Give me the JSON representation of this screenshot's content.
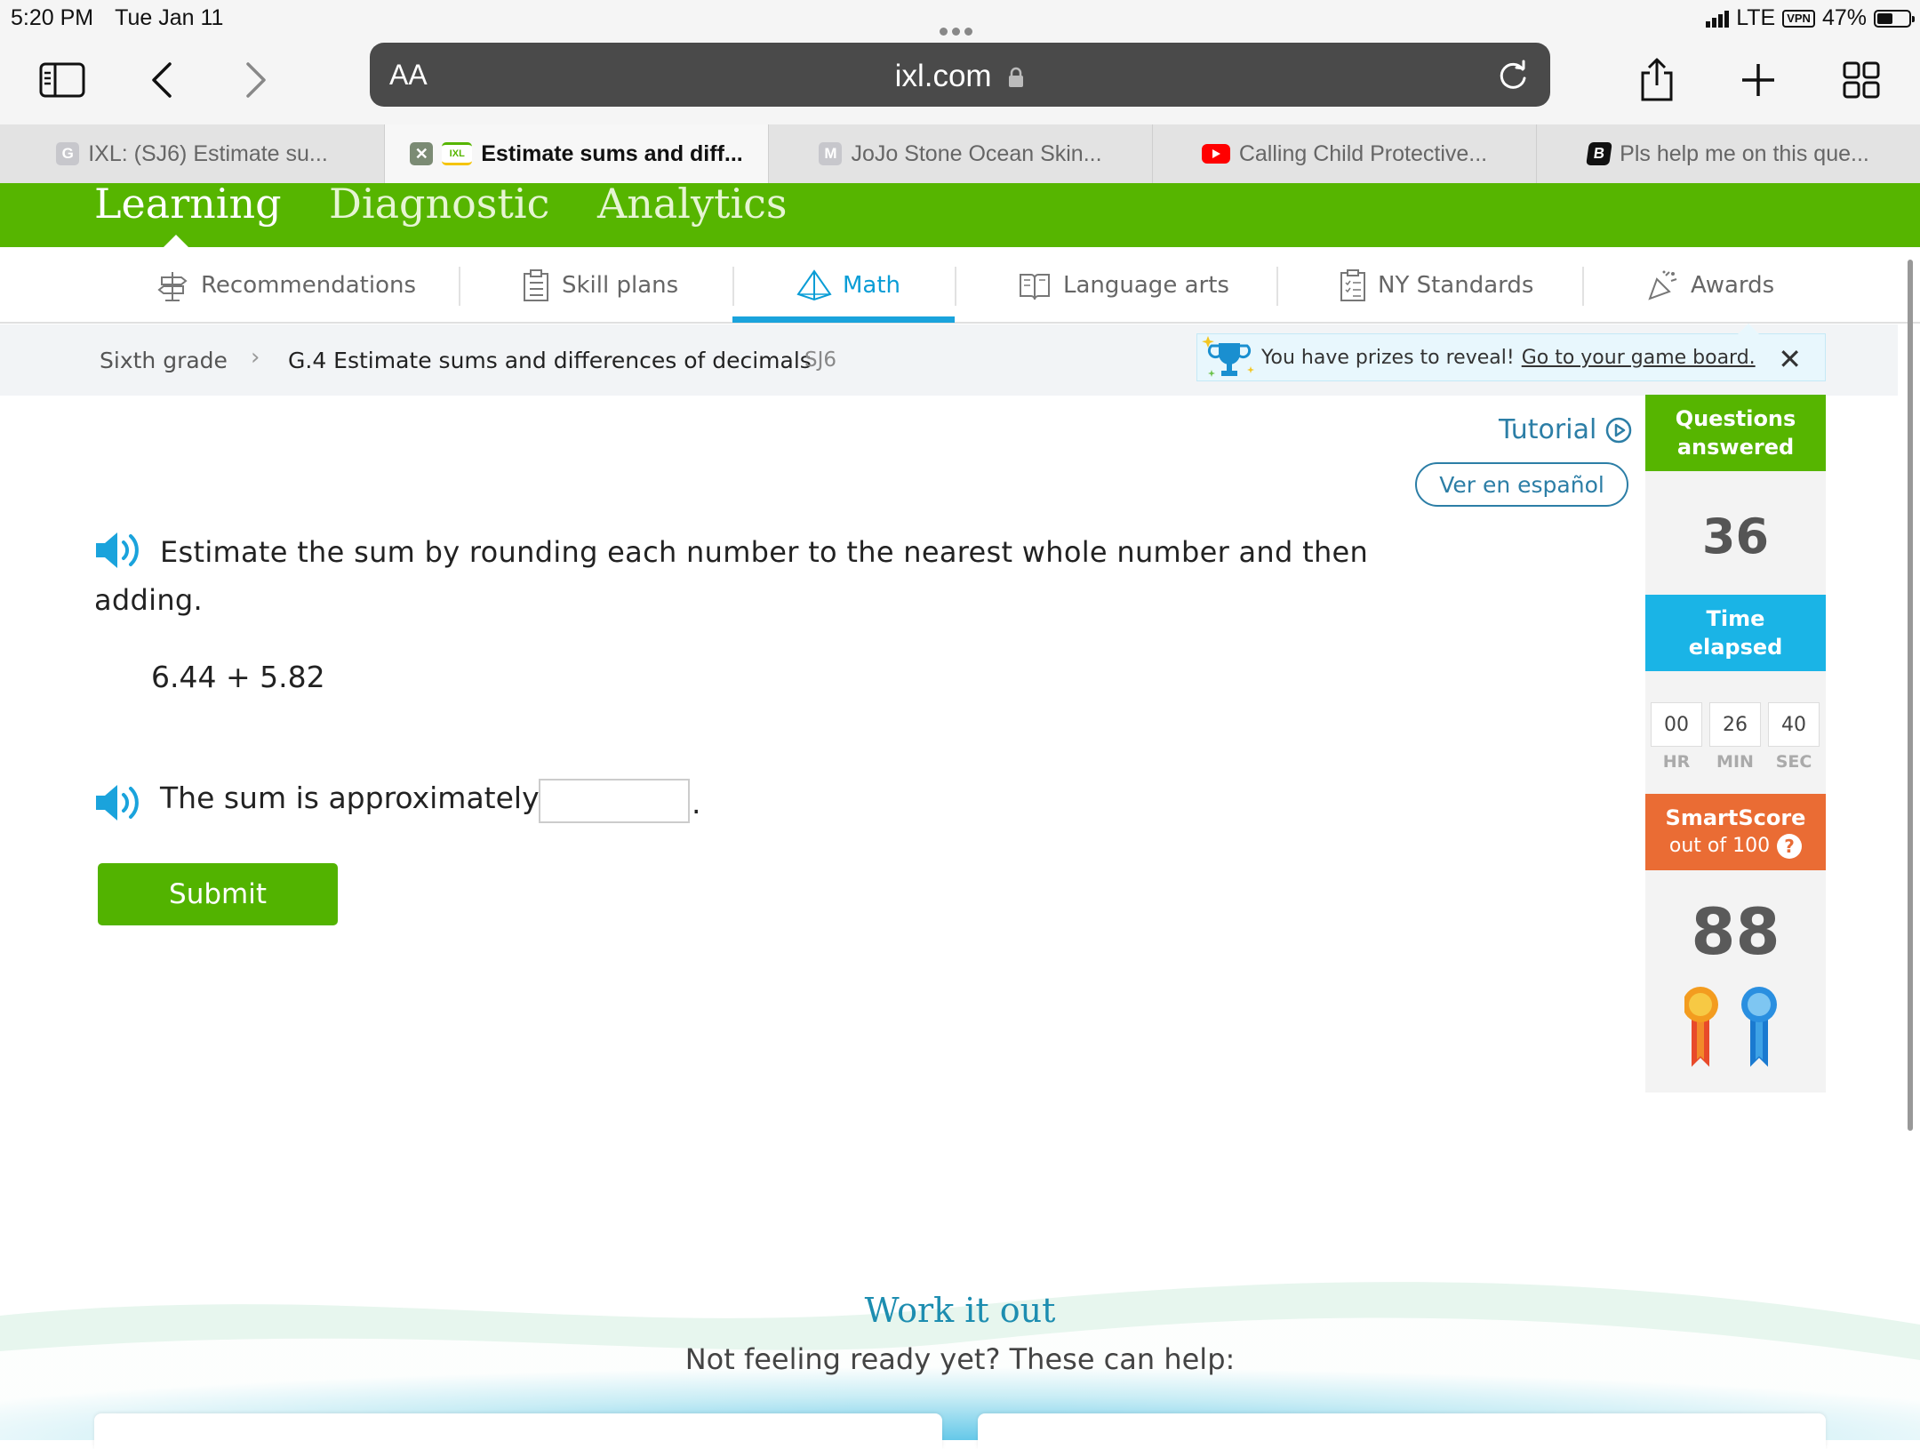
{
  "status_bar": {
    "time": "5:20 PM",
    "date": "Tue Jan 11",
    "network": "LTE",
    "vpn": "VPN",
    "battery": "47%"
  },
  "browser": {
    "aa_label": "AA",
    "url": "ixl.com",
    "tabs": [
      {
        "label": "IXL: (SJ6) Estimate su...",
        "favicon": "G",
        "favicon_color": "#c7c7cc"
      },
      {
        "label": "Estimate sums and diff...",
        "favicon": "IXL",
        "favicon_color": "#56b500"
      },
      {
        "label": "JoJo Stone Ocean Skin...",
        "favicon": "M",
        "favicon_color": "#c7c7cc"
      },
      {
        "label": "Calling Child Protective...",
        "favicon": "youtube-icon",
        "favicon_color": "#ff0000"
      },
      {
        "label": "Pls help me on this que...",
        "favicon": "B",
        "favicon_color": "#111111"
      }
    ]
  },
  "nav": {
    "items": [
      "Learning",
      "Diagnostic",
      "Analytics"
    ]
  },
  "subjects": {
    "items": [
      "Recommendations",
      "Skill plans",
      "Math",
      "Language arts",
      "NY Standards",
      "Awards"
    ],
    "active": "Math"
  },
  "breadcrumb": {
    "grade": "Sixth grade",
    "skill": "G.4 Estimate sums and differences of decimals",
    "code": "SJ6"
  },
  "prize_banner": {
    "text": "You have prizes to reveal!",
    "link": "Go to your game board."
  },
  "question": {
    "tutorial": "Tutorial",
    "spanish": "Ver en español",
    "prompt": "Estimate the sum by rounding each number to the nearest whole number and then adding.",
    "expression": "6.44 + 5.82",
    "answer_label": "The sum is approximately",
    "answer_value": "",
    "submit": "Submit"
  },
  "stats": {
    "questions_label_1": "Questions",
    "questions_label_2": "answered",
    "questions_value": "36",
    "time_label_1": "Time",
    "time_label_2": "elapsed",
    "hr": "00",
    "min": "26",
    "sec": "40",
    "hr_label": "HR",
    "min_label": "MIN",
    "sec_label": "SEC",
    "smartscore_label": "SmartScore",
    "smartscore_sub": "out of 100",
    "smartscore_value": "88",
    "colors": {
      "questions": "#56b500",
      "time": "#1ab4e6",
      "smartscore": "#ea6c34"
    }
  },
  "work": {
    "title": "Work it out",
    "subtitle": "Not feeling ready yet? These can help:"
  }
}
